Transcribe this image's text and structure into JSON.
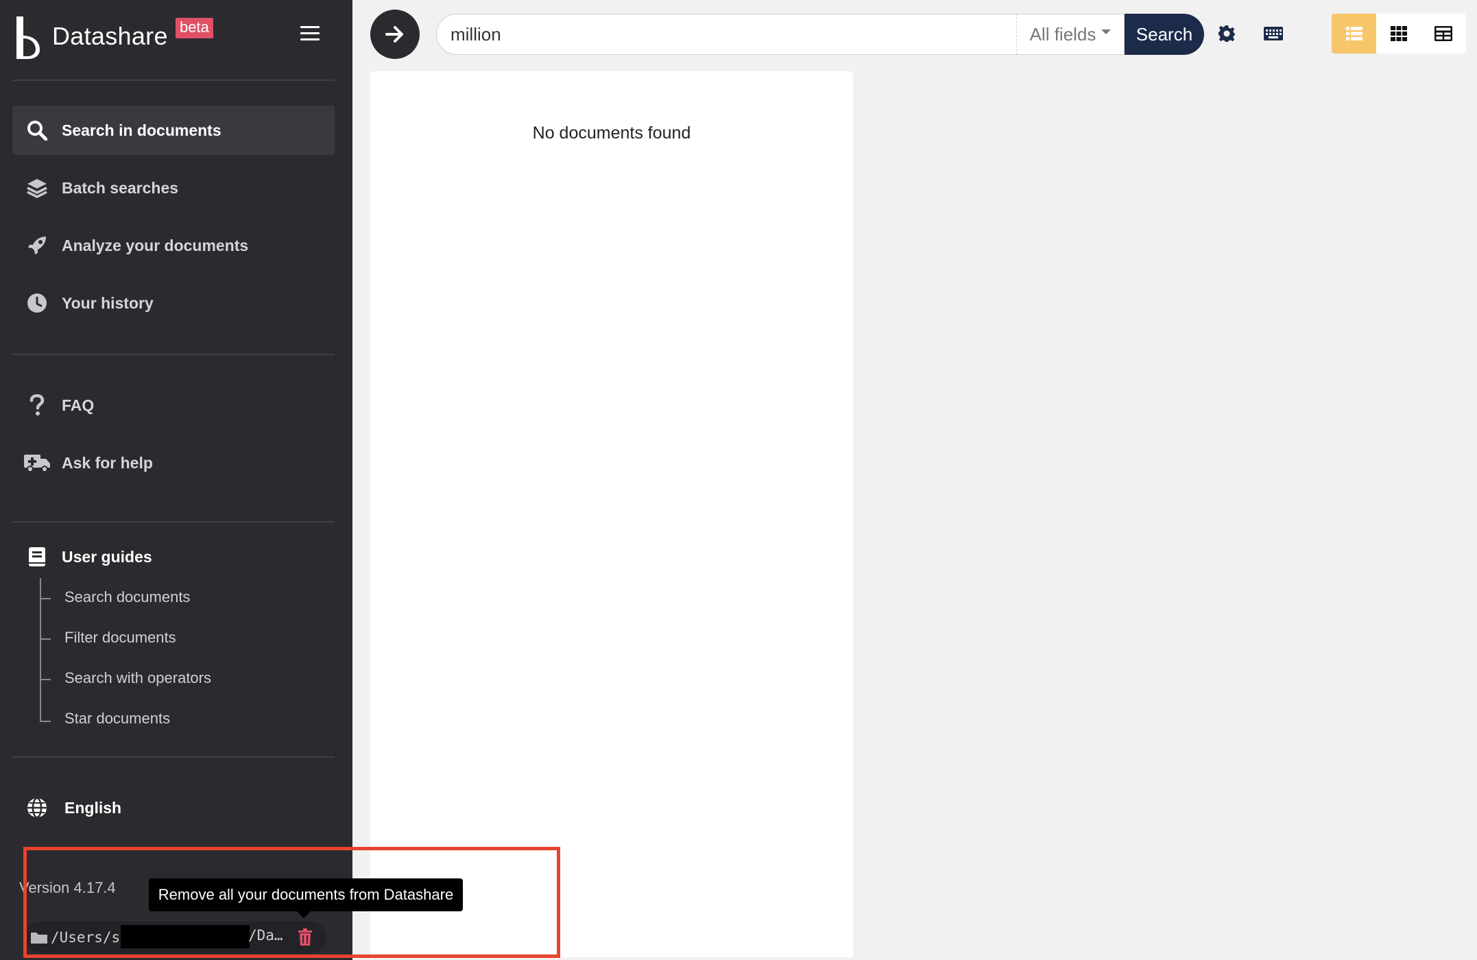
{
  "brand": {
    "name": "Datashare",
    "badge": "beta"
  },
  "sidebar": {
    "items": [
      {
        "label": "Search in documents",
        "icon": "search-icon",
        "active": true
      },
      {
        "label": "Batch searches",
        "icon": "layers-icon",
        "active": false
      },
      {
        "label": "Analyze your documents",
        "icon": "rocket-icon",
        "active": false
      },
      {
        "label": "Your history",
        "icon": "clock-icon",
        "active": false
      }
    ],
    "help": [
      {
        "label": "FAQ",
        "icon": "question-icon"
      },
      {
        "label": "Ask for help",
        "icon": "ambulance-icon"
      }
    ],
    "guides": {
      "title": "User guides",
      "links": [
        "Search documents",
        "Filter documents",
        "Search with operators",
        "Star documents"
      ]
    },
    "language": "English",
    "version": "Version 4.17.4",
    "path_start": "/Users/s",
    "path_end": "/Da…"
  },
  "tooltip": {
    "text": "Remove all your documents from Datashare"
  },
  "search": {
    "value": "million",
    "field": "All fields",
    "button": "Search"
  },
  "results": {
    "empty_message": "No documents found"
  },
  "colors": {
    "sidebar_bg": "#2b2b2f",
    "search_button": "#1c2b4a",
    "active_view": "#f8c66a",
    "beta_badge": "#e05066",
    "highlight": "#e8432e",
    "trash": "#e05066"
  }
}
